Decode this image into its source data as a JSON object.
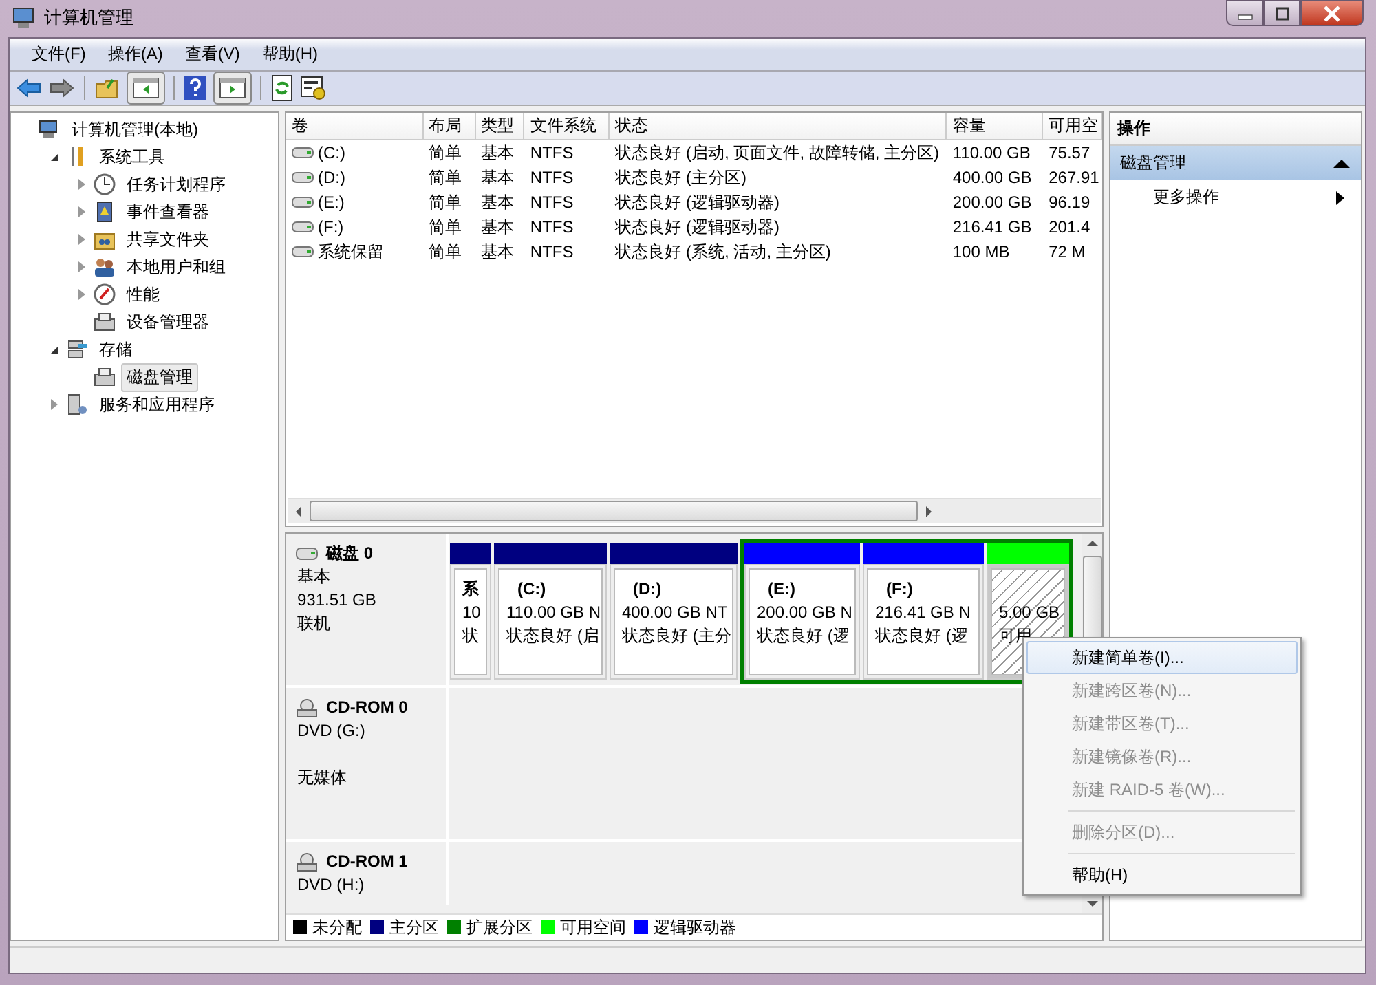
{
  "window": {
    "title": "计算机管理"
  },
  "menu": [
    "文件(F)",
    "操作(A)",
    "查看(V)",
    "帮助(H)"
  ],
  "tree": [
    {
      "label": "计算机管理(本地)",
      "kind": "computer",
      "selected": false,
      "children": [
        {
          "label": "系统工具",
          "kind": "tools",
          "expanded": true,
          "selected": false,
          "children": [
            {
              "label": "任务计划程序",
              "kind": "clock",
              "expanded": false,
              "selected": false
            },
            {
              "label": "事件查看器",
              "kind": "log",
              "expanded": false,
              "selected": false
            },
            {
              "label": "共享文件夹",
              "kind": "share",
              "expanded": false,
              "selected": false
            },
            {
              "label": "本地用户和组",
              "kind": "users",
              "expanded": false,
              "selected": false
            },
            {
              "label": "性能",
              "kind": "gauge",
              "expanded": false,
              "selected": false
            },
            {
              "label": "设备管理器",
              "kind": "device",
              "selected": false
            }
          ]
        },
        {
          "label": "存储",
          "kind": "storage",
          "expanded": true,
          "selected": false,
          "children": [
            {
              "label": "磁盘管理",
              "kind": "device",
              "selected": true
            }
          ]
        },
        {
          "label": "服务和应用程序",
          "kind": "services",
          "expanded": false,
          "selected": false
        }
      ]
    }
  ],
  "volume_table": {
    "columns": [
      "卷",
      "布局",
      "类型",
      "文件系统",
      "状态",
      "容量",
      "可用空"
    ],
    "rows": [
      [
        "(C:)",
        "简单",
        "基本",
        "NTFS",
        "状态良好 (启动, 页面文件, 故障转储, 主分区)",
        "110.00 GB",
        "75.57"
      ],
      [
        "(D:)",
        "简单",
        "基本",
        "NTFS",
        "状态良好 (主分区)",
        "400.00 GB",
        "267.91"
      ],
      [
        "(E:)",
        "简单",
        "基本",
        "NTFS",
        "状态良好 (逻辑驱动器)",
        "200.00 GB",
        "96.19"
      ],
      [
        "(F:)",
        "简单",
        "基本",
        "NTFS",
        "状态良好 (逻辑驱动器)",
        "216.41 GB",
        "201.4"
      ],
      [
        "系统保留",
        "简单",
        "基本",
        "NTFS",
        "状态良好 (系统, 活动, 主分区)",
        "100 MB",
        "72 M"
      ]
    ]
  },
  "disks": [
    {
      "name": "磁盘 0",
      "kind": "hdd",
      "type": "基本",
      "size": "931.51 GB",
      "status": "联机",
      "partitions": [
        {
          "kind": "primary",
          "label": "系",
          "size": "10",
          "status": "状",
          "selected": false
        },
        {
          "kind": "primary",
          "label": "(C:)",
          "size": "110.00 GB N",
          "status": "状态良好 (启",
          "selected": false
        },
        {
          "kind": "primary",
          "label": "(D:)",
          "size": "400.00 GB NT",
          "status": "状态良好 (主分",
          "selected": false
        },
        {
          "kind": "extended",
          "children": [
            {
              "kind": "logical",
              "label": "(E:)",
              "size": "200.00 GB N",
              "status": "状态良好 (逻",
              "selected": false
            },
            {
              "kind": "logical",
              "label": "(F:)",
              "size": "216.41 GB N",
              "status": "状态良好 (逻",
              "selected": false
            },
            {
              "kind": "free",
              "size": "5.00 GB",
              "status": "可用",
              "selected": true
            }
          ]
        }
      ]
    },
    {
      "name": "CD-ROM 0",
      "kind": "cdrom",
      "type": "DVD (G:)",
      "status": "无媒体"
    },
    {
      "name": "CD-ROM 1",
      "kind": "cdrom",
      "type": "DVD (H:)"
    }
  ],
  "legend": [
    {
      "label": "未分配",
      "color": "#000000"
    },
    {
      "label": "主分区",
      "color": "#000080"
    },
    {
      "label": "扩展分区",
      "color": "#008000"
    },
    {
      "label": "可用空间",
      "color": "#00ff00"
    },
    {
      "label": "逻辑驱动器",
      "color": "#0000ff"
    }
  ],
  "actions": {
    "title": "操作",
    "sections": [
      {
        "title": "磁盘管理",
        "expanded": true,
        "items": [
          "更多操作"
        ]
      }
    ]
  },
  "context_menu": [
    {
      "kind": "item",
      "label": "新建简单卷(I)...",
      "disabled": false,
      "selected": true
    },
    {
      "kind": "item",
      "label": "新建跨区卷(N)...",
      "disabled": true,
      "selected": false
    },
    {
      "kind": "item",
      "label": "新建带区卷(T)...",
      "disabled": true,
      "selected": false
    },
    {
      "kind": "item",
      "label": "新建镜像卷(R)...",
      "disabled": true,
      "selected": false
    },
    {
      "kind": "item",
      "label": "新建 RAID-5 卷(W)...",
      "disabled": true,
      "selected": false
    },
    {
      "kind": "separator"
    },
    {
      "kind": "item",
      "label": "删除分区(D)...",
      "disabled": true,
      "selected": false
    },
    {
      "kind": "separator"
    },
    {
      "kind": "item",
      "label": "帮助(H)",
      "disabled": false,
      "selected": false
    }
  ]
}
